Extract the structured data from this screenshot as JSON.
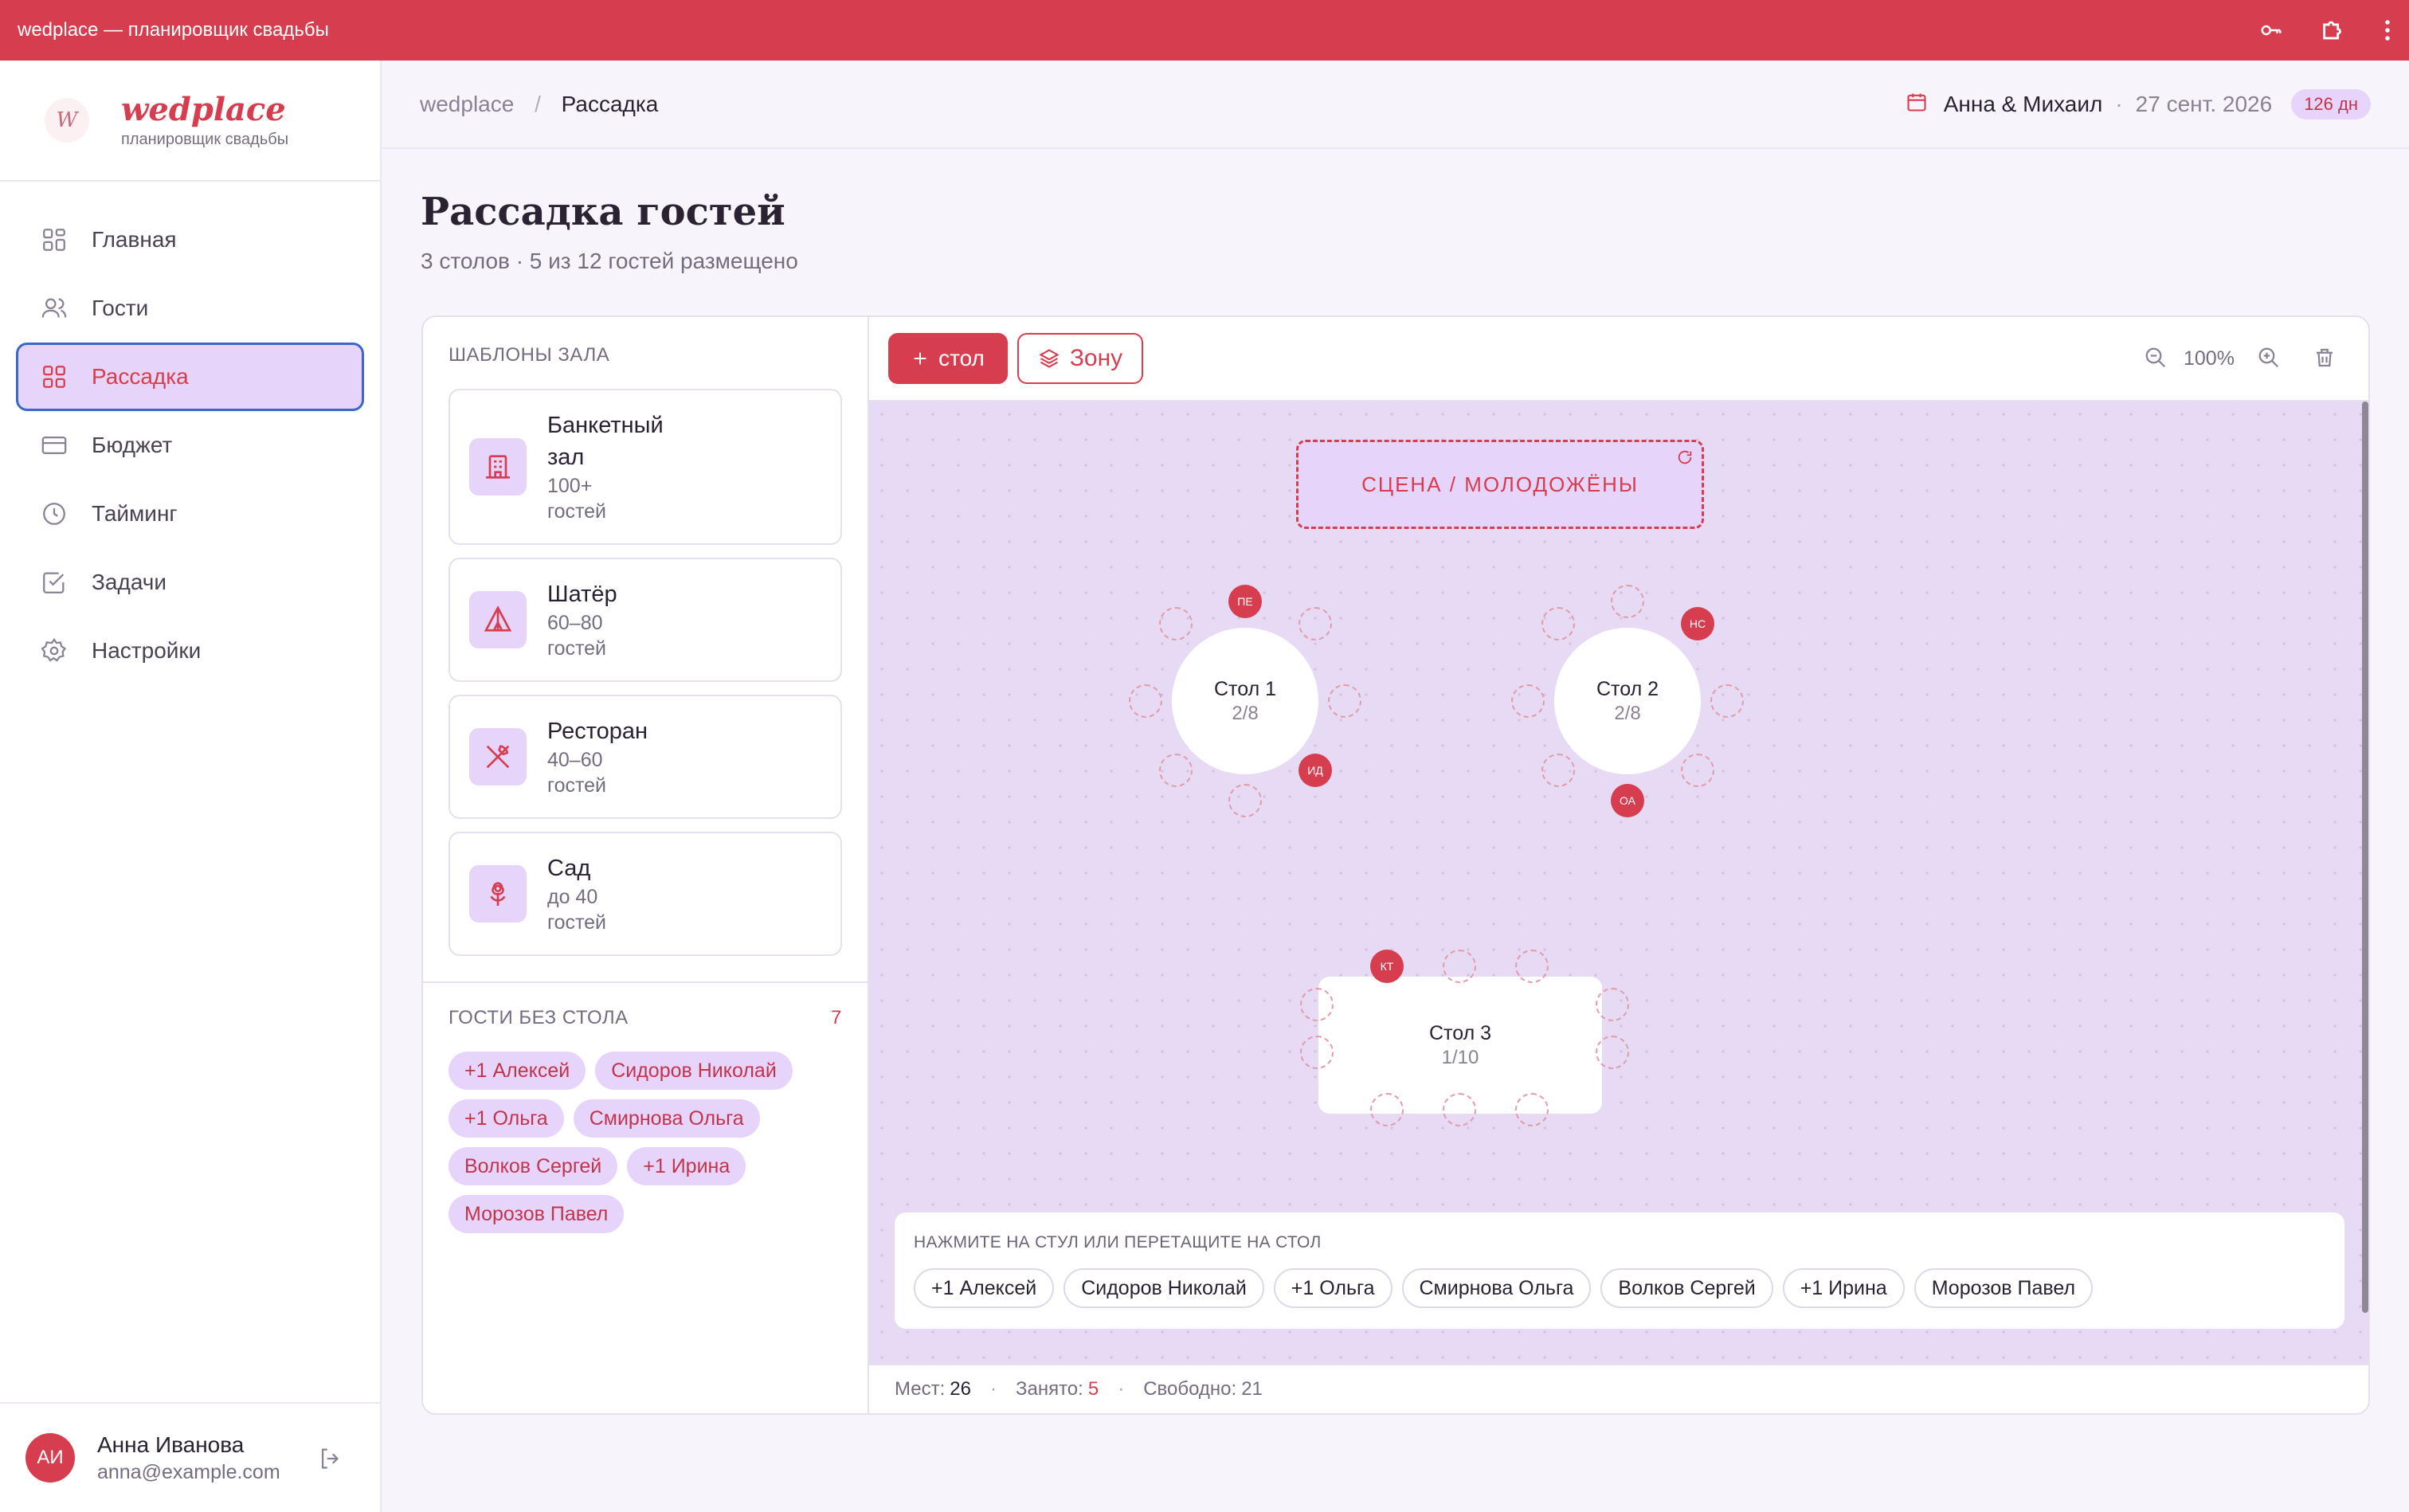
{
  "window": {
    "title": "wedplace — планировщик свадьбы"
  },
  "brand": {
    "logo_text": "W",
    "name": "wedplace",
    "subtitle": "планировщик свадьбы"
  },
  "nav": [
    {
      "label": "Главная",
      "icon": "grid-icon"
    },
    {
      "label": "Гости",
      "icon": "users-icon"
    },
    {
      "label": "Рассадка",
      "icon": "grid-icon",
      "active": true
    },
    {
      "label": "Бюджет",
      "icon": "card-icon"
    },
    {
      "label": "Тайминг",
      "icon": "clock-icon"
    },
    {
      "label": "Задачи",
      "icon": "checkbox-icon"
    },
    {
      "label": "Настройки",
      "icon": "gear-icon"
    }
  ],
  "user": {
    "initials": "АИ",
    "name": "Анна Иванова",
    "email": "anna@example.com"
  },
  "breadcrumb": {
    "root": "wedplace",
    "separator": "/",
    "current": "Рассадка"
  },
  "event": {
    "couple": "Анна & Михаил",
    "separator": "·",
    "date": "27 сент. 2026",
    "days_left": "126 дн"
  },
  "page": {
    "title": "Рассадка гостей",
    "subtitle": "3 столов · 5 из 12 гостей размещено"
  },
  "templates": {
    "label": "ШАБЛОНЫ ЗАЛА",
    "items": [
      {
        "name_line1": "Банкетный",
        "name_line2": "зал",
        "cap_line1": "100+",
        "cap_line2": "гостей",
        "icon": "building-icon"
      },
      {
        "name": "Шатёр",
        "cap_line1": "60–80",
        "cap_line2": "гостей",
        "icon": "tent-icon"
      },
      {
        "name": "Ресторан",
        "cap_line1": "40–60",
        "cap_line2": "гостей",
        "icon": "cutlery-icon"
      },
      {
        "name": "Сад",
        "cap_line1": "до 40",
        "cap_line2": "гостей",
        "icon": "flower-icon"
      }
    ]
  },
  "unseated": {
    "label": "ГОСТИ БЕЗ СТОЛА",
    "count": "7",
    "guests": [
      "+1 Алексей",
      "Сидоров Николай",
      "+1 Ольга",
      "Смирнова Ольга",
      "Волков Сергей",
      "+1 Ирина",
      "Морозов Павел"
    ]
  },
  "toolbar": {
    "add_table": "стол",
    "add_zone": "Зону",
    "zoom": "100%"
  },
  "floor": {
    "stage": "СЦЕНА / МОЛОДОЖЁНЫ",
    "tables": [
      {
        "name": "Стол 1",
        "count": "2/8",
        "taken": [
          "ПЕ",
          "ИД"
        ]
      },
      {
        "name": "Стол 2",
        "count": "2/8",
        "taken": [
          "НС",
          "ОА"
        ]
      },
      {
        "name": "Стол 3",
        "count": "1/10",
        "taken": [
          "КТ"
        ]
      }
    ],
    "hint": "НАЖМИТЕ НА СТУЛ ИЛИ ПЕРЕТАЩИТЕ НА СТОЛ",
    "drop_guests": [
      "+1 Алексей",
      "Сидоров Николай",
      "+1 Ольга",
      "Смирнова Ольга",
      "Волков Сергей",
      "+1 Ирина",
      "Морозов Павел"
    ]
  },
  "status": {
    "seats_label": "Мест:",
    "seats": "26",
    "taken_label": "Занято:",
    "taken": "5",
    "free_label": "Свободно:",
    "free": "21",
    "separator": "·"
  },
  "colors": {
    "accent": "#d63d4f",
    "lavender": "#e6d4fa",
    "canvas": "#e6daf5"
  }
}
